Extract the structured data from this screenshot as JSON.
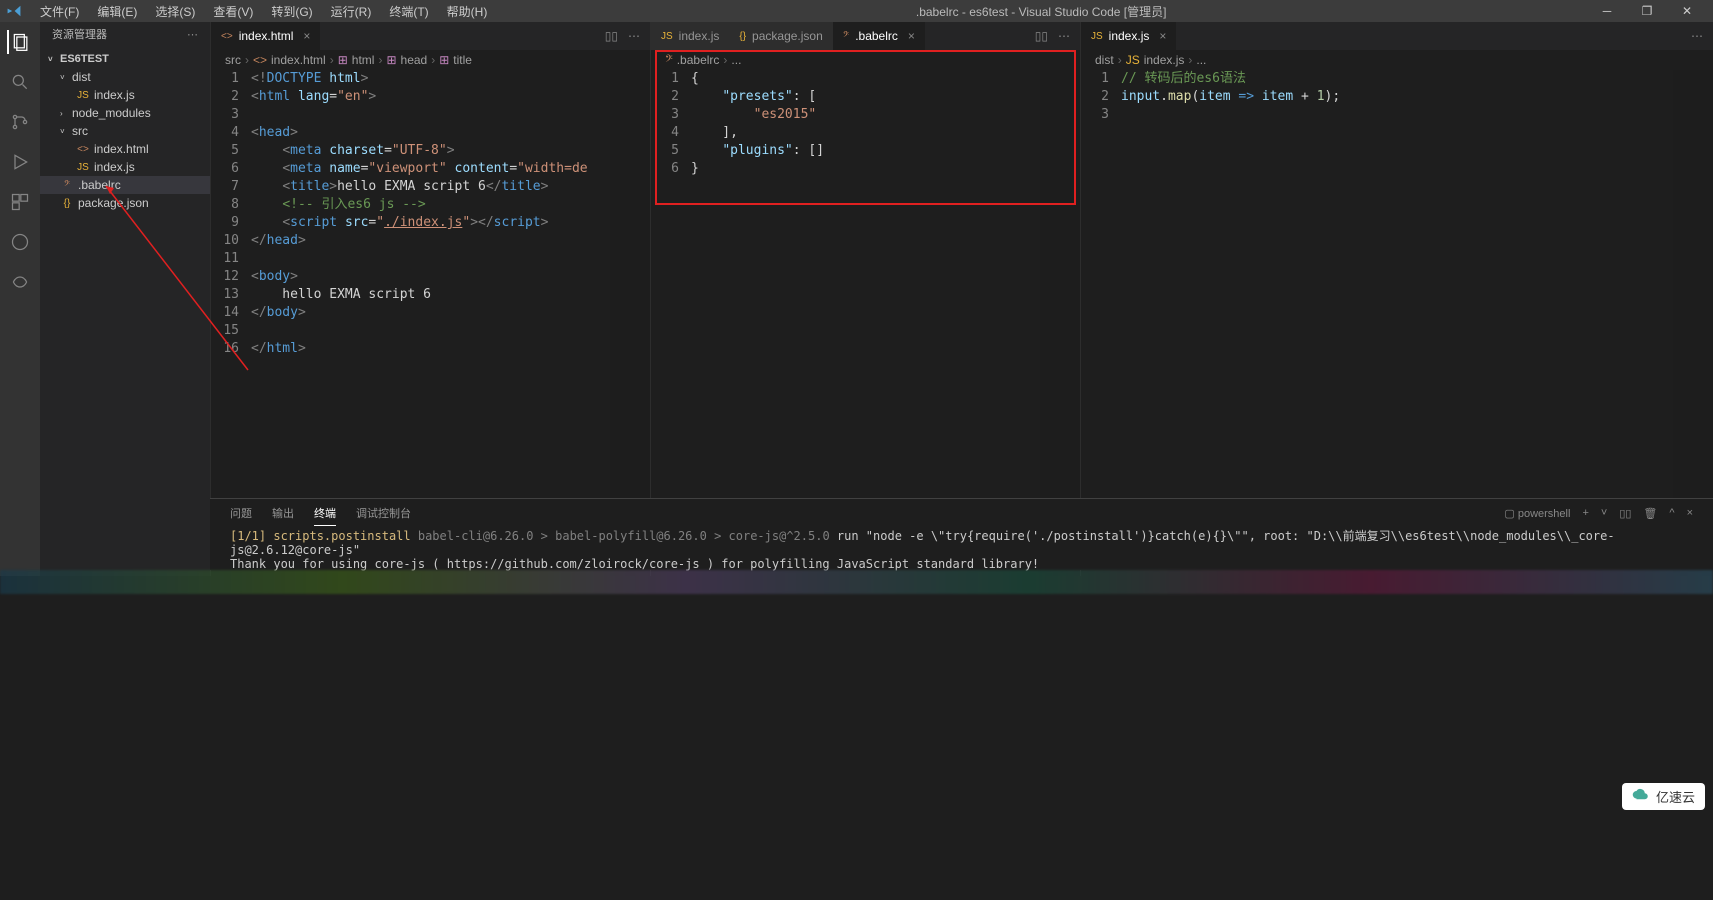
{
  "titlebar": {
    "menus": [
      "文件(F)",
      "编辑(E)",
      "选择(S)",
      "查看(V)",
      "转到(G)",
      "运行(R)",
      "终端(T)",
      "帮助(H)"
    ],
    "title": ".babelrc - es6test - Visual Studio Code [管理员]"
  },
  "sidebar": {
    "header": "资源管理器",
    "root": "ES6TEST",
    "items": [
      {
        "label": "dist",
        "type": "folder",
        "open": true,
        "indent": 1
      },
      {
        "label": "index.js",
        "type": "js",
        "indent": 2
      },
      {
        "label": "node_modules",
        "type": "folder",
        "open": false,
        "indent": 1
      },
      {
        "label": "src",
        "type": "folder",
        "open": true,
        "indent": 1
      },
      {
        "label": "index.html",
        "type": "html",
        "indent": 2
      },
      {
        "label": "index.js",
        "type": "js",
        "indent": 2
      },
      {
        "label": ".babelrc",
        "type": "babel",
        "indent": 1,
        "selected": true
      },
      {
        "label": "package.json",
        "type": "json",
        "indent": 1
      }
    ]
  },
  "group1": {
    "tabs": [
      {
        "label": "index.html",
        "icon": "html",
        "active": true
      }
    ],
    "breadcrumb": [
      "src",
      "index.html",
      "html",
      "head",
      "title"
    ],
    "code": [
      {
        "n": "1",
        "html": "<span class='punct'>&lt;!</span><span class='tag'>DOCTYPE</span> <span class='attr'>html</span><span class='punct'>&gt;</span>"
      },
      {
        "n": "2",
        "html": "<span class='punct'>&lt;</span><span class='tag'>html</span> <span class='attr'>lang</span>=<span class='str'>\"en\"</span><span class='punct'>&gt;</span>"
      },
      {
        "n": "3",
        "html": ""
      },
      {
        "n": "4",
        "html": "<span class='punct'>&lt;</span><span class='tag'>head</span><span class='punct'>&gt;</span>"
      },
      {
        "n": "5",
        "html": "    <span class='punct'>&lt;</span><span class='tag'>meta</span> <span class='attr'>charset</span>=<span class='str'>\"UTF-8\"</span><span class='punct'>&gt;</span>"
      },
      {
        "n": "6",
        "html": "    <span class='punct'>&lt;</span><span class='tag'>meta</span> <span class='attr'>name</span>=<span class='str'>\"viewport\"</span> <span class='attr'>content</span>=<span class='str'>\"width=de</span>"
      },
      {
        "n": "7",
        "html": "    <span class='punct'>&lt;</span><span class='tag'>title</span><span class='punct'>&gt;</span>hello EXMA script 6<span class='punct'>&lt;/</span><span class='tag'>title</span><span class='punct'>&gt;</span>"
      },
      {
        "n": "8",
        "html": "    <span class='comm'>&lt;!-- 引入es6 js --&gt;</span>"
      },
      {
        "n": "9",
        "html": "    <span class='punct'>&lt;</span><span class='tag'>script</span> <span class='attr'>src</span>=<span class='str'>\"<u>./index.js</u>\"</span><span class='punct'>&gt;&lt;/</span><span class='tag'>script</span><span class='punct'>&gt;</span>"
      },
      {
        "n": "10",
        "html": "<span class='punct'>&lt;/</span><span class='tag'>head</span><span class='punct'>&gt;</span>"
      },
      {
        "n": "11",
        "html": ""
      },
      {
        "n": "12",
        "html": "<span class='punct'>&lt;</span><span class='tag'>body</span><span class='punct'>&gt;</span>"
      },
      {
        "n": "13",
        "html": "    hello EXMA script 6"
      },
      {
        "n": "14",
        "html": "<span class='punct'>&lt;/</span><span class='tag'>body</span><span class='punct'>&gt;</span>"
      },
      {
        "n": "15",
        "html": ""
      },
      {
        "n": "16",
        "html": "<span class='punct'>&lt;/</span><span class='tag'>html</span><span class='punct'>&gt;</span>"
      }
    ]
  },
  "group2": {
    "tabs": [
      {
        "label": "index.js",
        "icon": "js",
        "active": false
      },
      {
        "label": "package.json",
        "icon": "json",
        "active": false
      },
      {
        "label": ".babelrc",
        "icon": "babel",
        "active": true
      }
    ],
    "breadcrumb": [
      ".babelrc",
      "..."
    ],
    "code": [
      {
        "n": "1",
        "html": "{"
      },
      {
        "n": "2",
        "html": "    <span class='prop'>\"presets\"</span>: ["
      },
      {
        "n": "3",
        "html": "        <span class='str'>\"es2015\"</span>"
      },
      {
        "n": "4",
        "html": "    ],"
      },
      {
        "n": "5",
        "html": "    <span class='prop'>\"plugins\"</span>: []"
      },
      {
        "n": "6",
        "html": "}"
      }
    ]
  },
  "group3": {
    "tabs": [
      {
        "label": "index.js",
        "icon": "js",
        "active": true
      }
    ],
    "breadcrumb": [
      "dist",
      "index.js",
      "..."
    ],
    "code": [
      {
        "n": "1",
        "html": "<span class='comm'>// 转码后的es6语法</span>"
      },
      {
        "n": "2",
        "html": "<span class='var'>input</span>.<span class='fn'>map</span>(<span class='var'>item</span> <span class='kw'>=&gt;</span> <span class='var'>item</span> + <span style='color:#b5cea8'>1</span>);"
      },
      {
        "n": "3",
        "html": ""
      }
    ]
  },
  "panel": {
    "tabs": [
      "问题",
      "输出",
      "终端",
      "调试控制台"
    ],
    "active": 2,
    "shell": "powershell",
    "lines": [
      "<span class='term-yellow'>[1/1] scripts.postinstall</span> <span class='term-gray'>babel-cli@6.26.0 &gt; babel-polyfill@6.26.0 &gt; core-js@^2.5.0</span> run \"node -e \\\"try{require('./postinstall')}catch(e){}\\\"\", root: \"D:\\\\前端复习\\\\es6test\\\\node_modules\\\\_core-js@2.6.12@core-js\"",
      "Thank you for using core-js ( https://github.com/zloirock/core-js ) for polyfilling JavaScript standard library!"
    ]
  },
  "watermark": "亿速云"
}
